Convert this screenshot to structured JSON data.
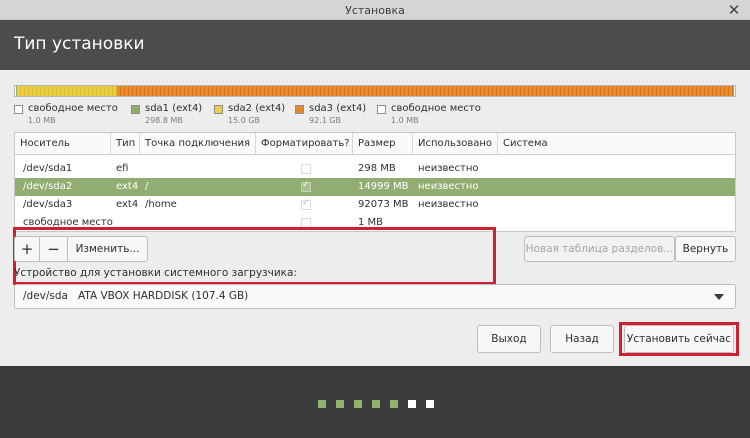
{
  "window": {
    "title": "Установка"
  },
  "header": {
    "title": "Тип установки"
  },
  "legend": [
    {
      "label": "свободное место",
      "size": "1.0 MB",
      "color": "#ffffff"
    },
    {
      "label": "sda1 (ext4)",
      "size": "298.8 MB",
      "color": "#8fae6b"
    },
    {
      "label": "sda2 (ext4)",
      "size": "15.0 GB",
      "color": "#e9cf48"
    },
    {
      "label": "sda3 (ext4)",
      "size": "92.1 GB",
      "color": "#e6892d"
    },
    {
      "label": "свободное место",
      "size": "1.0 MB",
      "color": "#ffffff"
    }
  ],
  "table": {
    "columns": [
      "Носитель",
      "Тип",
      "Точка подключения",
      "Форматировать?",
      "Размер",
      "Использовано",
      "Система"
    ],
    "rows": [
      {
        "device": "/dev/sda1",
        "type": "efi",
        "mount": "",
        "format": false,
        "size": "298 MB",
        "used": "неизвестно",
        "system": "",
        "selected": false
      },
      {
        "device": "/dev/sda2",
        "type": "ext4",
        "mount": "/",
        "format": true,
        "size": "14999 MB",
        "used": "неизвестно",
        "system": "",
        "selected": true
      },
      {
        "device": "/dev/sda3",
        "type": "ext4",
        "mount": "/home",
        "format": true,
        "size": "92073 MB",
        "used": "неизвестно",
        "system": "",
        "selected": false
      },
      {
        "device": "свободное место",
        "type": "",
        "mount": "",
        "format": false,
        "size": "1 MB",
        "used": "",
        "system": "",
        "selected": false
      }
    ]
  },
  "toolbar": {
    "add_label": "+",
    "remove_label": "−",
    "edit_label": "Изменить...",
    "new_table_label": "Новая таблица разделов...",
    "revert_label": "Вернуть"
  },
  "bootloader": {
    "label": "Устройство для установки системного загрузчика:",
    "selected": "/dev/sda   ATA VBOX HARDDISK (107.4 GB)"
  },
  "actions": {
    "quit_label": "Выход",
    "back_label": "Назад",
    "install_label": "Установить сейчас"
  },
  "progress": {
    "total_steps": 7,
    "completed_steps": 5
  },
  "colors": {
    "accent": "#91ad72",
    "highlight": "#d0202f",
    "header_bg": "#4c4c4c"
  }
}
